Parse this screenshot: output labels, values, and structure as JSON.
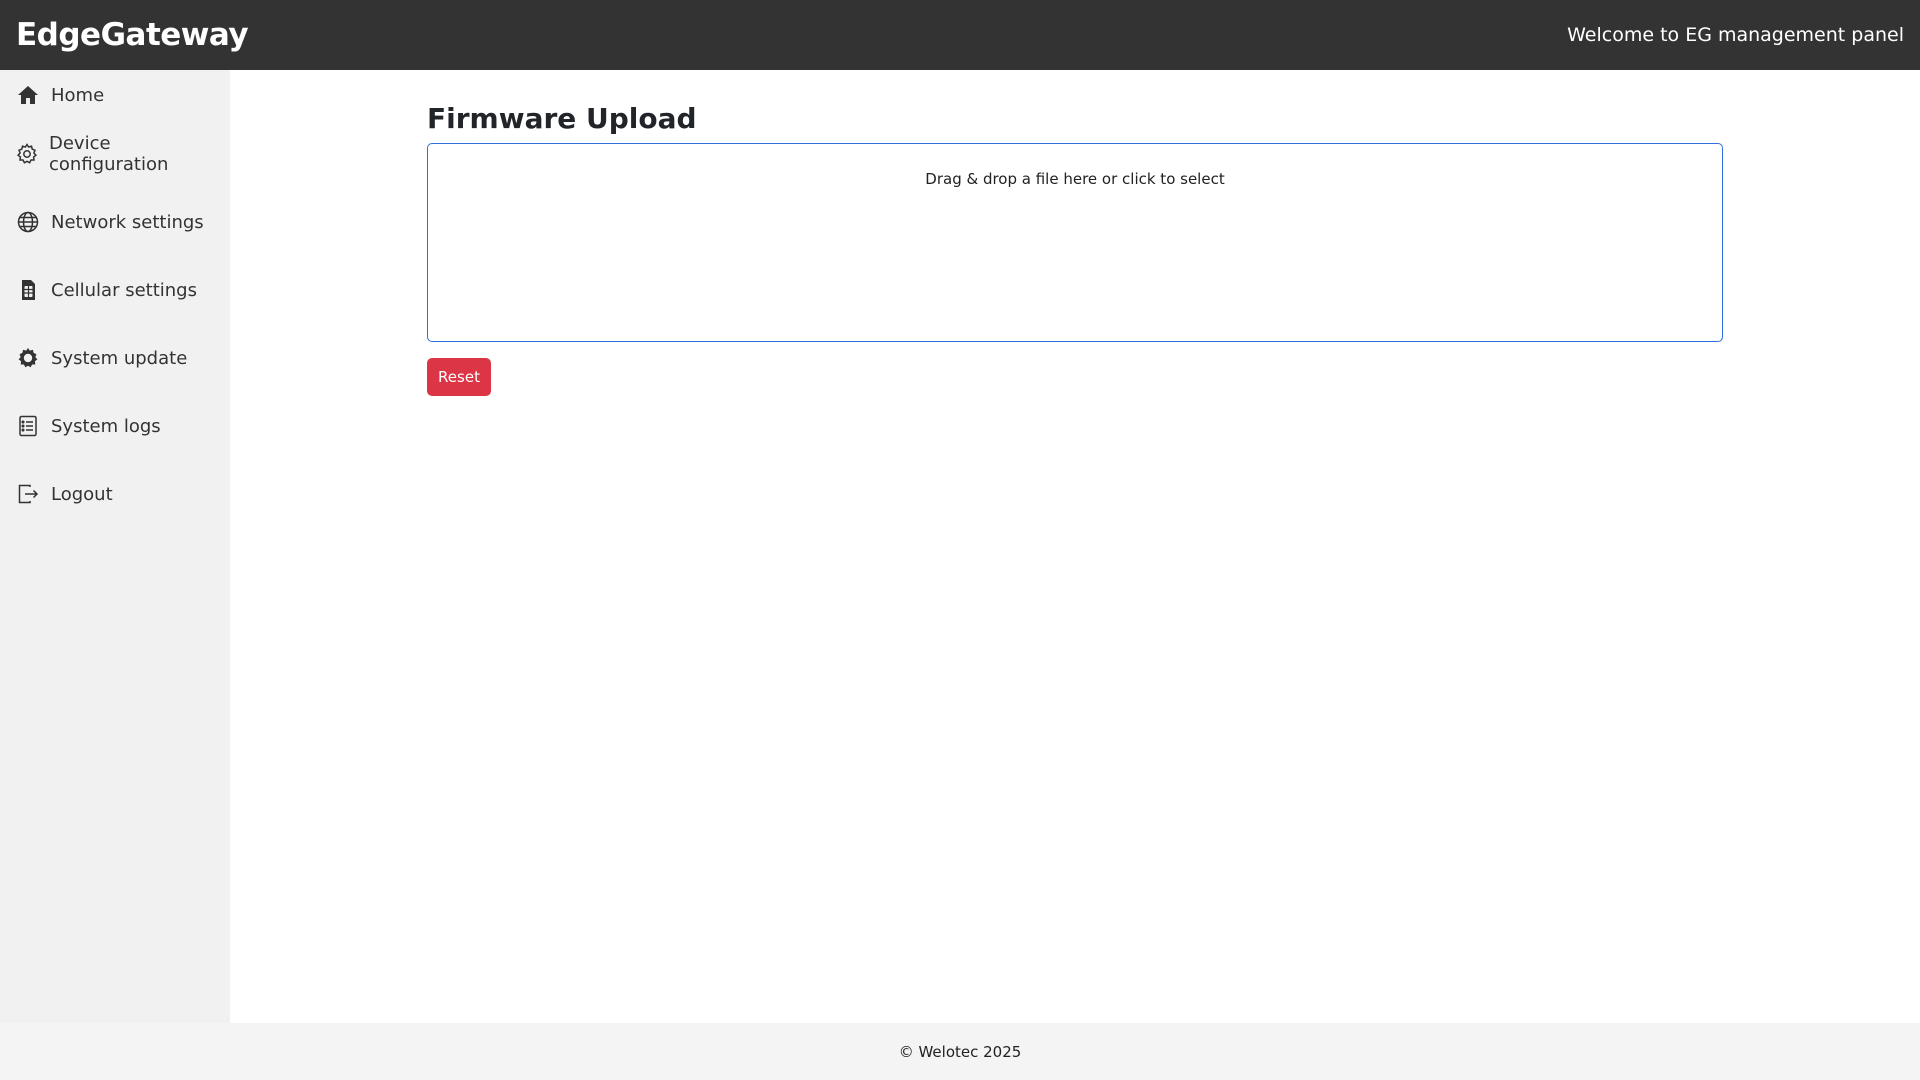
{
  "header": {
    "brand": "EdgeGateway",
    "welcome": "Welcome to EG management panel"
  },
  "sidebar": {
    "items": [
      {
        "label": "Home",
        "icon": "home-icon"
      },
      {
        "label": "Device configuration",
        "icon": "gear-icon"
      },
      {
        "label": "Network settings",
        "icon": "globe-icon"
      },
      {
        "label": "Cellular settings",
        "icon": "sim-card-icon"
      },
      {
        "label": "System update",
        "icon": "cog-filled-icon"
      },
      {
        "label": "System logs",
        "icon": "list-document-icon"
      },
      {
        "label": "Logout",
        "icon": "logout-icon"
      }
    ]
  },
  "main": {
    "title": "Firmware Upload",
    "dropzone_text": "Drag & drop a file here or click to select",
    "reset_label": "Reset"
  },
  "footer": {
    "copyright": "© Welotec 2025"
  },
  "colors": {
    "topbar": "#333333",
    "sidebar": "#f1f1f1",
    "dropzone_border": "#2f6fe0",
    "reset_button": "#dc3545"
  }
}
